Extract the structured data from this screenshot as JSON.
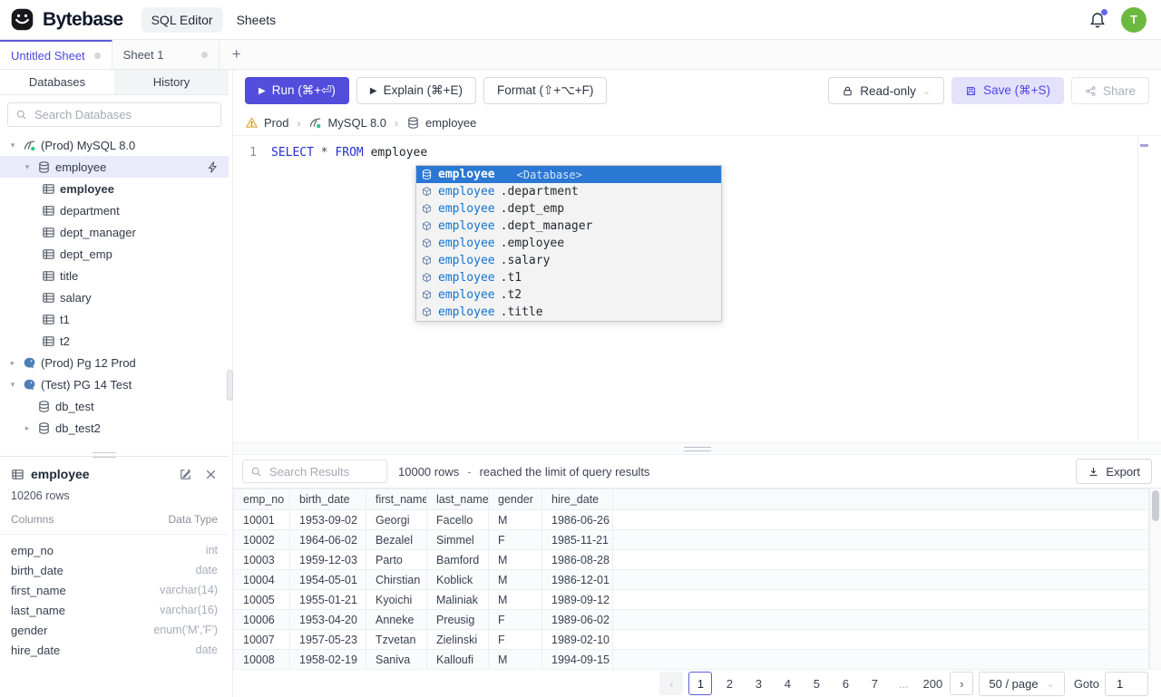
{
  "header": {
    "brand": "Bytebase",
    "nav_sql_editor": "SQL Editor",
    "nav_sheets": "Sheets",
    "avatar": "T"
  },
  "tabs": {
    "untitled": "Untitled Sheet",
    "sheet1": "Sheet 1",
    "add": "+"
  },
  "sidebar": {
    "tab_databases": "Databases",
    "tab_history": "History",
    "search_placeholder": "Search Databases",
    "tree": [
      {
        "label": "(Prod) MySQL 8.0"
      },
      {
        "label": "employee"
      },
      {
        "label": "employee"
      },
      {
        "label": "department"
      },
      {
        "label": "dept_manager"
      },
      {
        "label": "dept_emp"
      },
      {
        "label": "title"
      },
      {
        "label": "salary"
      },
      {
        "label": "t1"
      },
      {
        "label": "t2"
      },
      {
        "label": "(Prod) Pg 12 Prod"
      },
      {
        "label": "(Test) PG 14 Test"
      },
      {
        "label": "db_test"
      },
      {
        "label": "db_test2"
      }
    ]
  },
  "schema_panel": {
    "title": "employee",
    "row_count": "10206 rows",
    "columns_header": "Columns",
    "type_header": "Data Type",
    "columns": [
      {
        "name": "emp_no",
        "type": "int"
      },
      {
        "name": "birth_date",
        "type": "date"
      },
      {
        "name": "first_name",
        "type": "varchar(14)"
      },
      {
        "name": "last_name",
        "type": "varchar(16)"
      },
      {
        "name": "gender",
        "type": "enum('M','F')"
      },
      {
        "name": "hire_date",
        "type": "date"
      }
    ]
  },
  "toolbar": {
    "run": "Run (⌘+⏎)",
    "explain": "Explain (⌘+E)",
    "format": "Format (⇧+⌥+F)",
    "readonly": "Read-only",
    "save": "Save (⌘+S)",
    "share": "Share"
  },
  "breadcrumb": {
    "env": "Prod",
    "instance": "MySQL 8.0",
    "database": "employee"
  },
  "editor": {
    "line_number": "1",
    "kw_select": "SELECT",
    "star": "*",
    "kw_from": "FROM",
    "table": "employee"
  },
  "suggest": {
    "selected": {
      "label": "employee",
      "hint": "<Database>"
    },
    "items": [
      {
        "prefix": "employee",
        "suffix": ".department"
      },
      {
        "prefix": "employee",
        "suffix": ".dept_emp"
      },
      {
        "prefix": "employee",
        "suffix": ".dept_manager"
      },
      {
        "prefix": "employee",
        "suffix": ".employee"
      },
      {
        "prefix": "employee",
        "suffix": ".salary"
      },
      {
        "prefix": "employee",
        "suffix": ".t1"
      },
      {
        "prefix": "employee",
        "suffix": ".t2"
      },
      {
        "prefix": "employee",
        "suffix": ".title"
      }
    ]
  },
  "results": {
    "search_placeholder": "Search Results",
    "row_count": "10000 rows",
    "separator": "-",
    "limit_note": "reached the limit of query results",
    "export": "Export",
    "table": {
      "headers": [
        "emp_no",
        "birth_date",
        "first_name",
        "last_name",
        "gender",
        "hire_date"
      ],
      "rows": [
        [
          "10001",
          "1953-09-02",
          "Georgi",
          "Facello",
          "M",
          "1986-06-26"
        ],
        [
          "10002",
          "1964-06-02",
          "Bezalel",
          "Simmel",
          "F",
          "1985-11-21"
        ],
        [
          "10003",
          "1959-12-03",
          "Parto",
          "Bamford",
          "M",
          "1986-08-28"
        ],
        [
          "10004",
          "1954-05-01",
          "Chirstian",
          "Koblick",
          "M",
          "1986-12-01"
        ],
        [
          "10005",
          "1955-01-21",
          "Kyoichi",
          "Maliniak",
          "M",
          "1989-09-12"
        ],
        [
          "10006",
          "1953-04-20",
          "Anneke",
          "Preusig",
          "F",
          "1989-06-02"
        ],
        [
          "10007",
          "1957-05-23",
          "Tzvetan",
          "Zielinski",
          "F",
          "1989-02-10"
        ],
        [
          "10008",
          "1958-02-19",
          "Saniva",
          "Kalloufi",
          "M",
          "1994-09-15"
        ]
      ]
    },
    "pagination": {
      "prev": "‹",
      "pages": [
        "1",
        "2",
        "3",
        "4",
        "5",
        "6",
        "7"
      ],
      "ellipsis": "...",
      "last": "200",
      "next": "›",
      "page_size": "50 / page",
      "goto_label": "Goto",
      "goto_value": "1"
    }
  }
}
